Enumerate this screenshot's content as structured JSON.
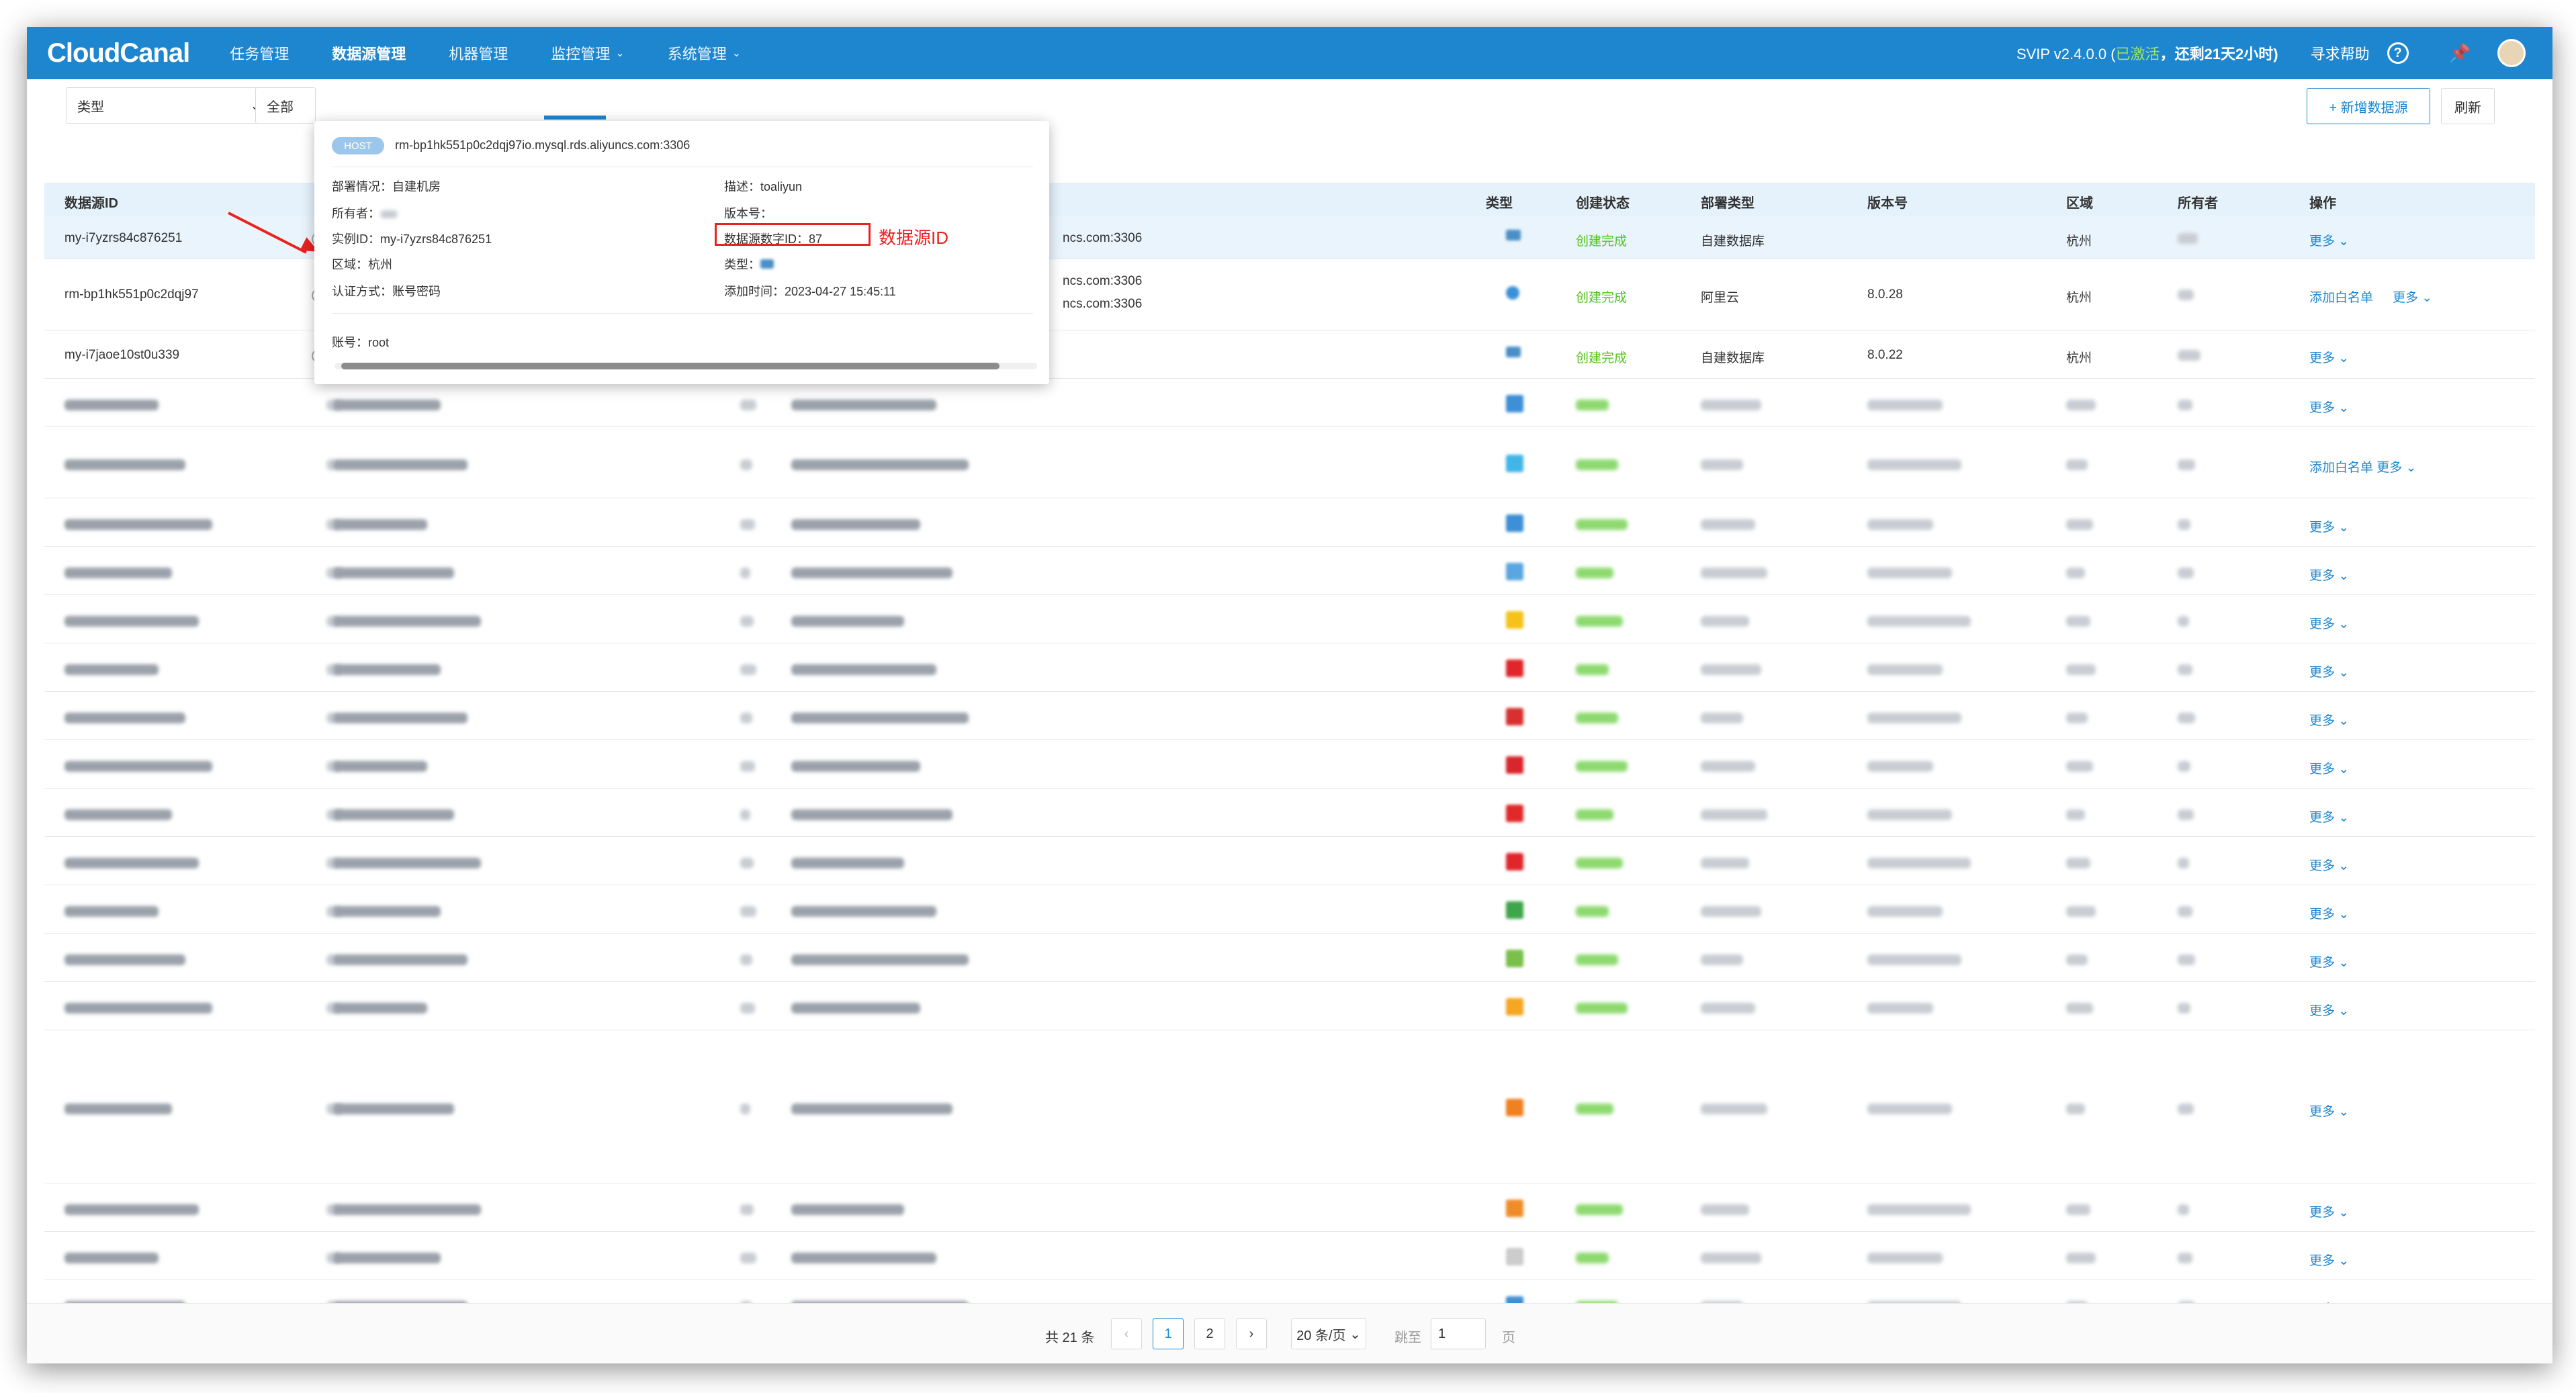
{
  "header": {
    "logo": "CloudCanal",
    "nav": [
      {
        "label": "任务管理",
        "dropdown": false,
        "active": false
      },
      {
        "label": "数据源管理",
        "dropdown": false,
        "active": true
      },
      {
        "label": "机器管理",
        "dropdown": false,
        "active": false
      },
      {
        "label": "监控管理",
        "dropdown": true,
        "active": false
      },
      {
        "label": "系统管理",
        "dropdown": true,
        "active": false
      }
    ],
    "version": "SVIP v2.4.0.0",
    "activated_prefix": "(",
    "activated": "已激活",
    "remaining": "，还剩21天2小时)",
    "help": "寻求帮助",
    "help_icon": "?",
    "pin_icon": "pin-icon"
  },
  "filters": {
    "type_select": "类型",
    "all_select": "全部",
    "add_button": "+ 新增数据源",
    "refresh_button": "刷新"
  },
  "table": {
    "columns": [
      "数据源ID",
      "类型",
      "创建状态",
      "部署类型",
      "版本号",
      "区域",
      "所有者",
      "操作"
    ],
    "rows": [
      {
        "id": "my-i7yzrs84c876251",
        "host_suffix": "ncs.com:3306",
        "status": "创建完成",
        "deploy": "自建数据库",
        "version": "",
        "region": "杭州",
        "actions": [
          "更多"
        ]
      },
      {
        "id": "rm-bp1hk551p0c2dqj97",
        "host_suffix": "ncs.com:3306",
        "host_suffix2": "ncs.com:3306",
        "status": "创建完成",
        "deploy": "阿里云",
        "version": "8.0.28",
        "region": "杭州",
        "actions": [
          "添加白名单",
          "更多"
        ]
      },
      {
        "id": "my-i7jaoe10st0u339",
        "host_suffix": "",
        "status": "创建完成",
        "deploy": "自建数据库",
        "version": "8.0.22",
        "region": "杭州",
        "actions": [
          "更多"
        ]
      }
    ],
    "more_label": "更多",
    "whitelist_label": "添加白名单"
  },
  "popup": {
    "host_badge": "HOST",
    "host": "rm-bp1hk551p0c2dqj97io.mysql.rds.aliyuncs.com:3306",
    "deploy": "部署情况：自建机房",
    "desc": "描述：toaliyun",
    "owner": "所有者：",
    "version": "版本号：",
    "instance": "实例ID：my-i7yzrs84c876251",
    "numeric_id": "数据源数字ID：87",
    "region": "区域：杭州",
    "type": "类型：",
    "auth": "认证方式：账号密码",
    "added": "添加时间：2023-04-27 15:45:11",
    "account": "账号：root",
    "annotation": "数据源ID"
  },
  "pager": {
    "total": "共 21 条",
    "pages": [
      "1",
      "2"
    ],
    "prev": "‹",
    "next": "›",
    "size": "20 条/页",
    "goto": "跳至",
    "goto_value": "1",
    "page_unit": "页"
  }
}
